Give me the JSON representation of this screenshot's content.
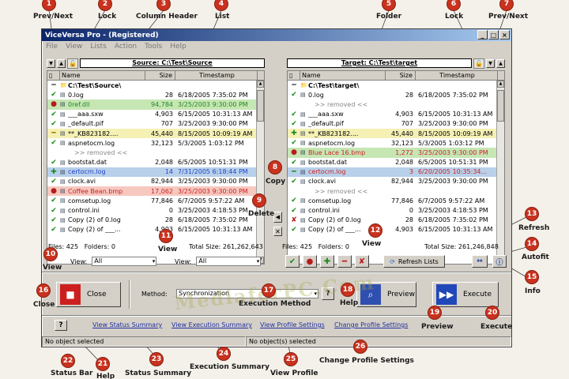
{
  "window": {
    "title": "ViceVersa Pro - (Registered)",
    "menu": [
      "File",
      "View",
      "Lists",
      "Action",
      "Tools",
      "Help"
    ]
  },
  "callouts": [
    {
      "num": "1",
      "label": "Prev/Next"
    },
    {
      "num": "2",
      "label": "Lock"
    },
    {
      "num": "3",
      "label": "Column Header"
    },
    {
      "num": "4",
      "label": "List"
    },
    {
      "num": "5",
      "label": "Folder"
    },
    {
      "num": "6",
      "label": "Lock"
    },
    {
      "num": "7",
      "label": "Prev/Next"
    },
    {
      "num": "8",
      "label": "Copy"
    },
    {
      "num": "9",
      "label": "Delete"
    },
    {
      "num": "10",
      "label": "View"
    },
    {
      "num": "11",
      "label": "View"
    },
    {
      "num": "12",
      "label": "View"
    },
    {
      "num": "13",
      "label": "Refresh"
    },
    {
      "num": "14",
      "label": "Autofit"
    },
    {
      "num": "15",
      "label": "Info"
    },
    {
      "num": "16",
      "label": "Close"
    },
    {
      "num": "17",
      "label": "Execution Method"
    },
    {
      "num": "18",
      "label": "Help"
    },
    {
      "num": "19",
      "label": "Preview"
    },
    {
      "num": "20",
      "label": "Execute"
    },
    {
      "num": "21",
      "label": "Help"
    },
    {
      "num": "22",
      "label": "Status Bar"
    },
    {
      "num": "23",
      "label": "Status Summary"
    },
    {
      "num": "24",
      "label": "Execution Summary"
    },
    {
      "num": "25",
      "label": "View Profile"
    },
    {
      "num": "26",
      "label": "Change Profile Settings"
    }
  ],
  "columns": {
    "name": "Name",
    "size": "Size",
    "timestamp": "Timestamp"
  },
  "source": {
    "path": "Source: C:\\Test\\Source",
    "root": "C:\\Test\\Source\\",
    "rows": [
      {
        "status": "✔",
        "sc": "g",
        "name": "0.log",
        "size": "28",
        "ts": "6/18/2005 7:35:02 PM",
        "hl": "",
        "tc": ""
      },
      {
        "status": "●",
        "sc": "r",
        "name": "0ref.dll",
        "size": "94,784",
        "ts": "3/25/2003 9:30:00 PM",
        "hl": "hl-green",
        "tc": "txt-green"
      },
      {
        "status": "✔",
        "sc": "g",
        "name": "___aaa.sxw",
        "size": "4,903",
        "ts": "6/15/2005 10:31:13 AM",
        "hl": "",
        "tc": ""
      },
      {
        "status": "✔",
        "sc": "g",
        "name": "_default.pif",
        "size": "707",
        "ts": "3/25/2003 9:30:00 PM",
        "hl": "",
        "tc": ""
      },
      {
        "status": "━",
        "sc": "y",
        "name": "**_KB823182....",
        "size": "45,440",
        "ts": "8/15/2005 10:09:19 AM",
        "hl": "hl-yellow",
        "tc": ""
      },
      {
        "status": "✔",
        "sc": "g",
        "name": "aspnetocm.log",
        "size": "32,123",
        "ts": "5/3/2005 1:03:12 PM",
        "hl": "",
        "tc": ""
      },
      {
        "removed": ">> removed <<"
      },
      {
        "status": "✔",
        "sc": "g",
        "name": "bootstat.dat",
        "size": "2,048",
        "ts": "6/5/2005 10:51:31 PM",
        "hl": "",
        "tc": ""
      },
      {
        "status": "✚",
        "sc": "g",
        "name": "certocm.log",
        "size": "14",
        "ts": "7/31/2005 6:18:44 PM",
        "hl": "hl-blue",
        "tc": "txt-blue"
      },
      {
        "status": "✔",
        "sc": "g",
        "name": "clock.avi",
        "size": "82,944",
        "ts": "3/25/2003 9:30:00 PM",
        "hl": "",
        "tc": ""
      },
      {
        "status": "●",
        "sc": "r",
        "name": "Coffee Bean.bmp",
        "size": "17,062",
        "ts": "3/25/2003 9:30:00 PM",
        "hl": "hl-red",
        "tc": "txt-red"
      },
      {
        "status": "✔",
        "sc": "g",
        "name": "comsetup.log",
        "size": "77,846",
        "ts": "6/7/2005 9:57:22 AM",
        "hl": "",
        "tc": ""
      },
      {
        "status": "✔",
        "sc": "g",
        "name": "control.ini",
        "size": "0",
        "ts": "3/25/2003 4:18:53 PM",
        "hl": "",
        "tc": ""
      },
      {
        "status": "✔",
        "sc": "g",
        "name": "Copy (2) of 0.log",
        "size": "28",
        "ts": "6/18/2005 7:35:02 PM",
        "hl": "",
        "tc": ""
      },
      {
        "status": "✔",
        "sc": "g",
        "name": "Copy (2) of ___...",
        "size": "4,903",
        "ts": "6/15/2005 10:31:13 AM",
        "hl": "",
        "tc": ""
      }
    ],
    "files": "Files: 425",
    "folders": "Folders: 0",
    "total": "Total Size: 261,262,643"
  },
  "target": {
    "path": "Target: C:\\Test\\target",
    "root": "C:\\Test\\target\\",
    "rows": [
      {
        "status": "✔",
        "sc": "g",
        "name": "0.log",
        "size": "28",
        "ts": "6/18/2005 7:35:02 PM",
        "hl": "",
        "tc": ""
      },
      {
        "removed": ">> removed <<"
      },
      {
        "status": "✔",
        "sc": "g",
        "name": "___aaa.sxw",
        "size": "4,903",
        "ts": "6/15/2005 10:31:13 AM",
        "hl": "",
        "tc": ""
      },
      {
        "status": "✔",
        "sc": "g",
        "name": "_default.pif",
        "size": "707",
        "ts": "3/25/2003 9:30:00 PM",
        "hl": "",
        "tc": ""
      },
      {
        "status": "✚",
        "sc": "g",
        "name": "**_KB823182....",
        "size": "45,440",
        "ts": "8/15/2005 10:09:19 AM",
        "hl": "hl-yellow",
        "tc": ""
      },
      {
        "status": "✔",
        "sc": "g",
        "name": "aspnetocm.log",
        "size": "32,123",
        "ts": "5/3/2005 1:03:12 PM",
        "hl": "",
        "tc": ""
      },
      {
        "status": "●",
        "sc": "r",
        "name": "Blue Lace 16.bmp",
        "size": "1,272",
        "ts": "3/25/2003 9:30:00 PM",
        "hl": "hl-green",
        "tc": "txt-red"
      },
      {
        "status": "✔",
        "sc": "g",
        "name": "bootstat.dat",
        "size": "2,048",
        "ts": "6/5/2005 10:51:31 PM",
        "hl": "",
        "tc": ""
      },
      {
        "status": "━",
        "sc": "g",
        "name": "certocm.log",
        "size": "3",
        "ts": "6/20/2005 10:35:34...",
        "hl": "hl-blue",
        "tc": "txt-red"
      },
      {
        "status": "✔",
        "sc": "g",
        "name": "clock.avi",
        "size": "82,944",
        "ts": "3/25/2003 9:30:00 PM",
        "hl": "",
        "tc": ""
      },
      {
        "removed": ">> removed <<"
      },
      {
        "status": "✔",
        "sc": "g",
        "name": "comsetup.log",
        "size": "77,846",
        "ts": "6/7/2005 9:57:22 AM",
        "hl": "",
        "tc": ""
      },
      {
        "status": "✔",
        "sc": "g",
        "name": "control.ini",
        "size": "0",
        "ts": "3/25/2003 4:18:53 PM",
        "hl": "",
        "tc": ""
      },
      {
        "status": "✘",
        "sc": "r",
        "name": "Copy (2) of 0.log",
        "size": "28",
        "ts": "6/18/2005 7:35:02 PM",
        "hl": "",
        "tc": ""
      },
      {
        "status": "✔",
        "sc": "g",
        "name": "Copy (2) of ___...",
        "size": "4,903",
        "ts": "6/15/2005 10:31:13 AM",
        "hl": "",
        "tc": ""
      }
    ],
    "files": "Files: 425",
    "folders": "Folders: 0",
    "total": "Total Size: 261,246,848"
  },
  "left_status_icons": [
    "✔",
    "●",
    "✔",
    "✔",
    "━",
    "✔",
    "●",
    "✔",
    "✚",
    "✔",
    "●",
    "✔",
    "✔",
    "✘",
    "✔"
  ],
  "view": {
    "label": "View:",
    "value": "All"
  },
  "buttons": {
    "refresh": "Refresh Lists",
    "close": "Close",
    "preview": "Preview",
    "execute": "Execute"
  },
  "method": {
    "label": "Method:",
    "value": "Synchronization"
  },
  "links": {
    "status_summary": "View Status Summary",
    "execution_summary": "View Execution Summary",
    "profile_settings": "View Profile Settings",
    "change_profile": "Change Profile Settings"
  },
  "statusbar": {
    "left": "No object selected",
    "right": "No object(s) selected"
  },
  "watermark": "MediaferPC.Com"
}
